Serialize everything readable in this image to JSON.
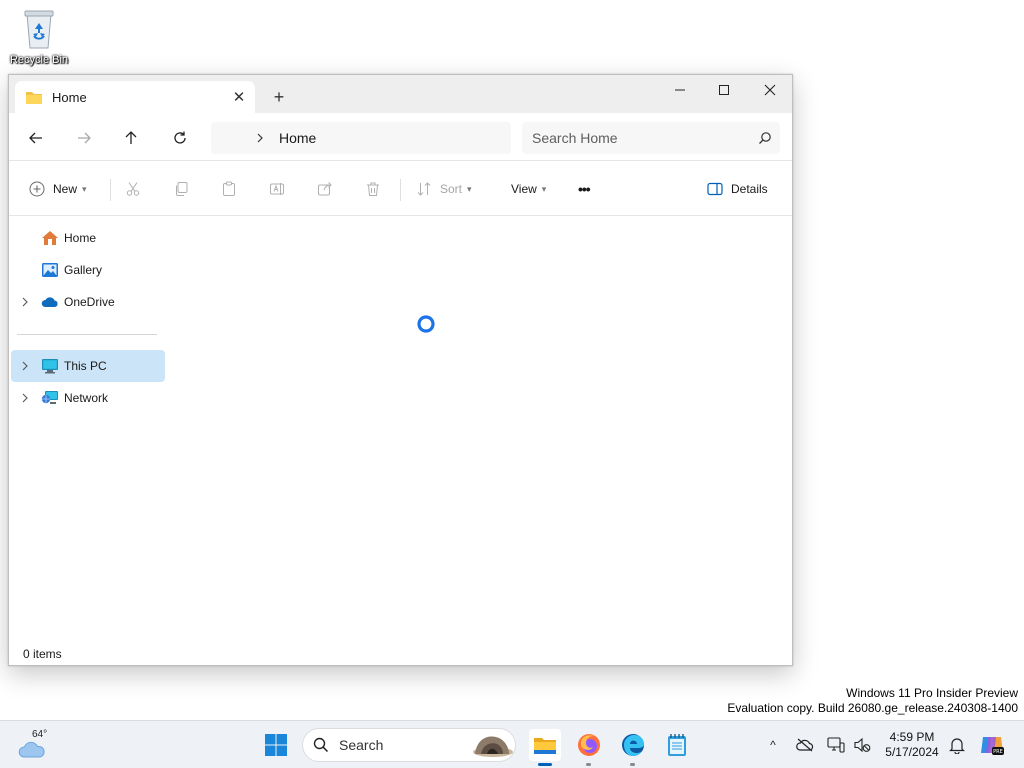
{
  "desktop": {
    "recycle_bin_label": "Recycle Bin",
    "watermark_line1": "Windows 11 Pro Insider Preview",
    "watermark_line2": "Evaluation copy. Build 26080.ge_release.240308-1400"
  },
  "window": {
    "tab_title": "Home",
    "new_tab_symbol": "+",
    "close_tab_symbol": "✕",
    "breadcrumb": "Home",
    "search_placeholder": "Search Home",
    "status_text": "0 items"
  },
  "toolbar": {
    "new_label": "New",
    "sort_label": "Sort",
    "view_label": "View",
    "more_label": "•••",
    "details_label": "Details"
  },
  "sidebar": {
    "items": [
      {
        "label": "Home",
        "icon": "home-icon",
        "expandable": false,
        "selected": false
      },
      {
        "label": "Gallery",
        "icon": "gallery-icon",
        "expandable": false,
        "selected": false
      },
      {
        "label": "OneDrive",
        "icon": "onedrive-icon",
        "expandable": true,
        "selected": false
      },
      {
        "label": "This PC",
        "icon": "this-pc-icon",
        "expandable": true,
        "selected": true
      },
      {
        "label": "Network",
        "icon": "network-icon",
        "expandable": true,
        "selected": false
      }
    ]
  },
  "taskbar": {
    "weather_temp": "64°",
    "search_label": "Search",
    "clock_time": "4:59 PM",
    "clock_date": "5/17/2024",
    "tray_chevron": "^"
  },
  "colors": {
    "accent": "#005fb8",
    "selection": "#cce4f7",
    "spinner": "#1a73e8"
  }
}
